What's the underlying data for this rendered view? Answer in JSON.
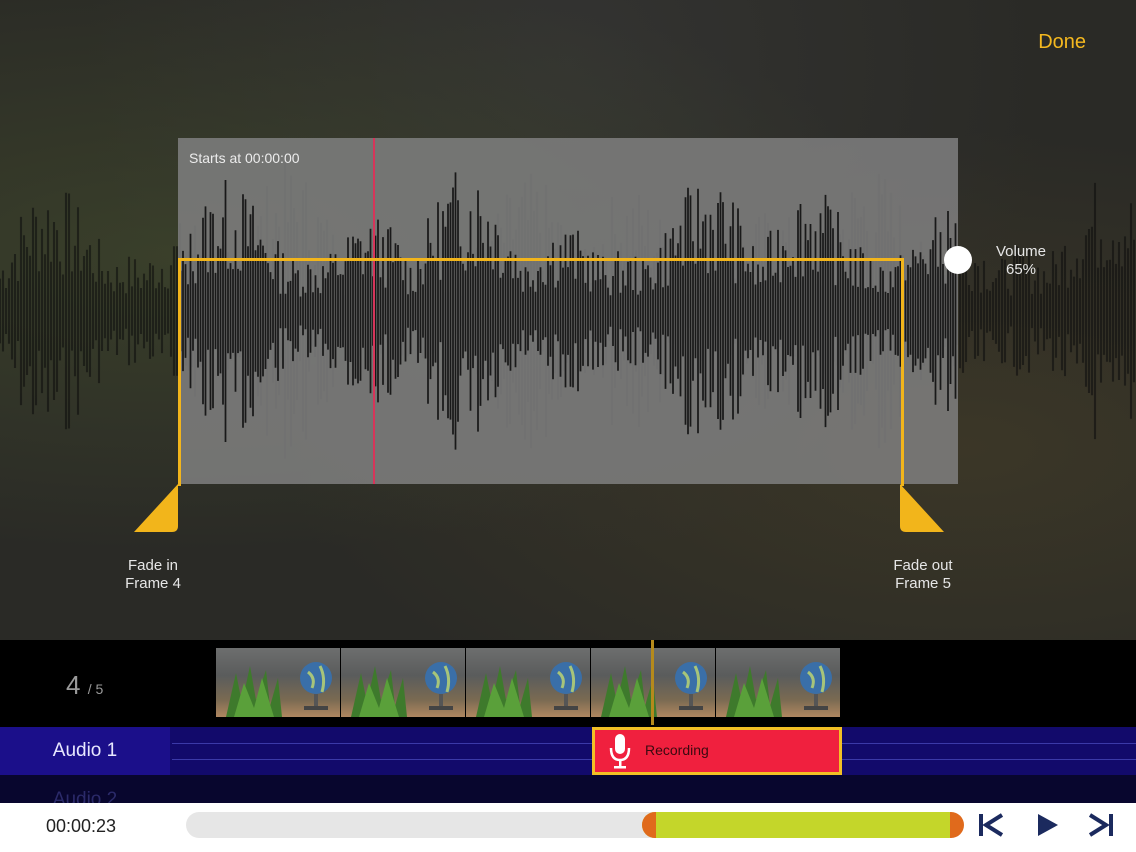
{
  "header": {
    "done_label": "Done"
  },
  "waveform": {
    "starts_label": "Starts at 00:00:00",
    "fade_in_label": "Fade in",
    "fade_in_frame": "Frame 4",
    "fade_out_label": "Fade out",
    "fade_out_frame": "Frame 5",
    "volume_label": "Volume",
    "volume_value": "65%"
  },
  "timeline": {
    "frame_current": "4",
    "frame_total": "/ 5",
    "tracks": [
      "Audio 1",
      "Audio 2"
    ],
    "clip_label": "Recording"
  },
  "transport": {
    "time": "00:00:23"
  },
  "colors": {
    "accent": "#f2b51b",
    "clip": "#f0203e",
    "track": "#120a6b",
    "selection": "#c4d62a"
  },
  "icons": [
    "microphone-icon",
    "skip-back-icon",
    "play-icon",
    "skip-forward-icon"
  ]
}
